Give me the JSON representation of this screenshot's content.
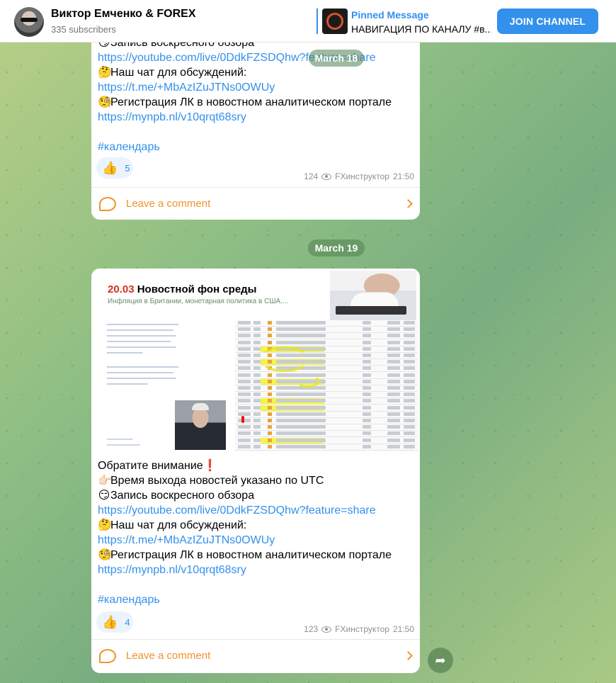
{
  "header": {
    "channel_title": "Виктор Емченко & FOREX",
    "subscribers": "335 subscribers",
    "pinned_label": "Pinned Message",
    "pinned_text": "НАВИГАЦИЯ ПО КАНАЛУ #в...",
    "join_label": "JOIN CHANNEL"
  },
  "message_1": {
    "lines": [
      {
        "emoji": "😏",
        "text": "Запись воскресного обзора"
      },
      {
        "link": "https://youtube.com/live/0DdkFZSDQhw?feature=share"
      },
      {
        "emoji": "🤔",
        "text": "Наш чат для обсуждений:"
      },
      {
        "link": "https://t.me/+MbAzIZuJTNs0OWUy"
      },
      {
        "emoji": "🧐",
        "text": "Регистрация ЛК в новостном аналитическом портале"
      },
      {
        "link": "https://mynpb.nl/v10qrqt68sry"
      }
    ],
    "hashtag": "#календарь",
    "reaction_emoji": "👍",
    "reaction_count": "5",
    "views": "124",
    "author": "FXинструктор",
    "time": "21:50",
    "comment_label": "Leave a comment"
  },
  "date_1": "March 18",
  "date_2": "March 19",
  "message_2": {
    "image": {
      "title_date": "20.03",
      "title_rest": " Новостной фон среды",
      "subtitle": "Инфляция в Бритaнии, монетарная политика в США...."
    },
    "lines": [
      {
        "text": "Обратите внимание",
        "emoji_after": "❗"
      },
      {
        "emoji": "👉🏻",
        "text": "Время выхода новостей указано по UTC"
      },
      {
        "emoji": "😏",
        "text": "Запись воскресного обзора"
      },
      {
        "link": "https://youtube.com/live/0DdkFZSDQhw?feature=share"
      },
      {
        "emoji": "🤔",
        "text": "Наш чат для обсуждений:"
      },
      {
        "link": "https://t.me/+MbAzIZuJTNs0OWUy"
      },
      {
        "emoji": "🧐",
        "text": "Регистрация ЛК в новостном аналитическом портале"
      },
      {
        "link": "https://mynpb.nl/v10qrqt68sry"
      }
    ],
    "hashtag": "#календарь",
    "reaction_emoji": "👍",
    "reaction_count": "4",
    "views": "123",
    "author": "FXинструктор",
    "time": "21:50",
    "comment_label": "Leave a comment"
  }
}
